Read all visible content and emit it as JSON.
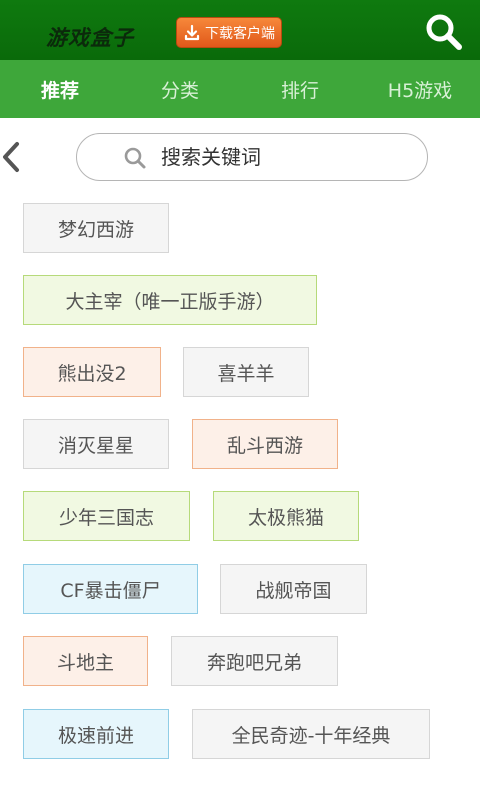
{
  "header": {
    "logo_text": "游戏盒子",
    "download_label": "下载客户端",
    "search_icon": "magnifier-icon"
  },
  "nav": {
    "tabs": [
      {
        "label": "推荐",
        "active": true
      },
      {
        "label": "分类",
        "active": false
      },
      {
        "label": "排行",
        "active": false
      },
      {
        "label": "H5游戏",
        "active": false
      }
    ]
  },
  "search": {
    "placeholder": "搜索关键词",
    "back_icon": "chevron-left-icon"
  },
  "colors": {
    "topbar": "#0a6a0a",
    "navbar": "#3ea73a",
    "download": "#e8661f",
    "tag_gray": "#f5f5f5",
    "tag_green": "#f1f9e2",
    "tag_orange": "#fdf0e8",
    "tag_blue": "#e6f6fc"
  },
  "hot_tags": [
    {
      "label": "梦幻西游",
      "style": "gray"
    },
    {
      "label": "大主宰（唯一正版手游）",
      "style": "green"
    },
    {
      "label": "熊出没2",
      "style": "orange"
    },
    {
      "label": "喜羊羊",
      "style": "gray"
    },
    {
      "label": "消灭星星",
      "style": "gray"
    },
    {
      "label": "乱斗西游",
      "style": "orange"
    },
    {
      "label": "少年三国志",
      "style": "green"
    },
    {
      "label": "太极熊猫",
      "style": "green"
    },
    {
      "label": "CF暴击僵尸",
      "style": "blue"
    },
    {
      "label": "战舰帝国",
      "style": "gray"
    },
    {
      "label": "斗地主",
      "style": "orange"
    },
    {
      "label": "奔跑吧兄弟",
      "style": "gray"
    },
    {
      "label": "极速前进",
      "style": "blue"
    },
    {
      "label": "全民奇迹-十年经典",
      "style": "gray"
    }
  ]
}
